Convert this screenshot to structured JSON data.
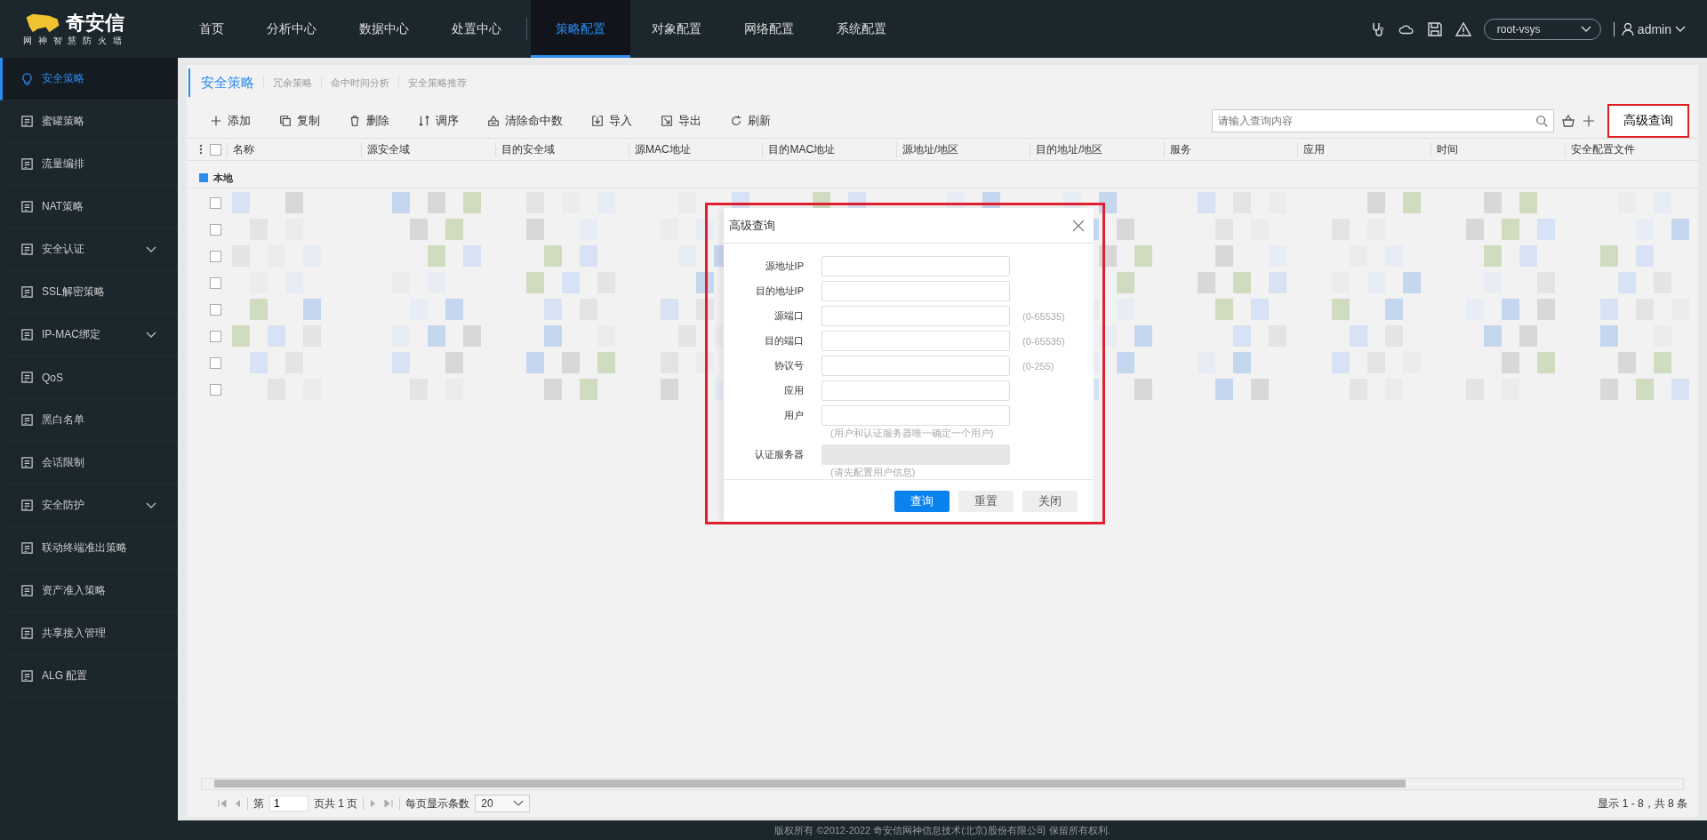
{
  "brand": {
    "name": "奇安信",
    "tagline": "网 神 智 慧 防 火 墙"
  },
  "top_nav": [
    {
      "label": "首页",
      "selected": false,
      "divider_before": false
    },
    {
      "label": "分析中心",
      "selected": false,
      "divider_before": false
    },
    {
      "label": "数据中心",
      "selected": false,
      "divider_before": false
    },
    {
      "label": "处置中心",
      "selected": false,
      "divider_before": false
    },
    {
      "label": "策略配置",
      "selected": true,
      "divider_before": true
    },
    {
      "label": "对象配置",
      "selected": false,
      "divider_before": false
    },
    {
      "label": "网络配置",
      "selected": false,
      "divider_before": false
    },
    {
      "label": "系统配置",
      "selected": false,
      "divider_before": false
    }
  ],
  "vsys_select": "root-vsys",
  "user": "admin",
  "sidebar": {
    "items": [
      {
        "label": "安全策略",
        "selected": true,
        "has_submenu": false
      },
      {
        "label": "蜜罐策略",
        "selected": false,
        "has_submenu": false
      },
      {
        "label": "流量编排",
        "selected": false,
        "has_submenu": false
      },
      {
        "label": "NAT策略",
        "selected": false,
        "has_submenu": false
      },
      {
        "label": "安全认证",
        "selected": false,
        "has_submenu": true
      },
      {
        "label": "SSL解密策略",
        "selected": false,
        "has_submenu": false
      },
      {
        "label": "IP-MAC绑定",
        "selected": false,
        "has_submenu": true
      },
      {
        "label": "QoS",
        "selected": false,
        "has_submenu": false
      },
      {
        "label": "黑白名单",
        "selected": false,
        "has_submenu": false
      },
      {
        "label": "会话限制",
        "selected": false,
        "has_submenu": false
      },
      {
        "label": "安全防护",
        "selected": false,
        "has_submenu": true
      },
      {
        "label": "联动终端准出策略",
        "selected": false,
        "has_submenu": false
      },
      {
        "label": "资产准入策略",
        "selected": false,
        "has_submenu": false
      },
      {
        "label": "共享接入管理",
        "selected": false,
        "has_submenu": false
      },
      {
        "label": "ALG 配置",
        "selected": false,
        "has_submenu": false
      }
    ]
  },
  "tabs": [
    {
      "label": "安全策略",
      "selected": true
    },
    {
      "label": "冗余策略",
      "selected": false
    },
    {
      "label": "命中时间分析",
      "selected": false
    },
    {
      "label": "安全策略推荐",
      "selected": false
    }
  ],
  "toolbar": [
    "添加",
    "复制",
    "删除",
    "调序",
    "清除命中数",
    "导入",
    "导出",
    "刷新"
  ],
  "search": {
    "placeholder": "请输入查询内容"
  },
  "advanced_button": "高级查询",
  "table": {
    "columns": [
      "名称",
      "源安全域",
      "目的安全域",
      "源MAC地址",
      "目的MAC地址",
      "源地址/地区",
      "目的地址/地区",
      "服务",
      "应用",
      "时间",
      "安全配置文件"
    ],
    "select_all": {
      "checked": false
    },
    "group": {
      "label": "本地",
      "expanded": true
    },
    "rows": [
      {
        "checked": false
      },
      {
        "checked": false
      },
      {
        "checked": false
      },
      {
        "checked": false
      },
      {
        "checked": false
      },
      {
        "checked": false
      },
      {
        "checked": false
      },
      {
        "checked": false
      }
    ]
  },
  "dialog": {
    "title": "高级查询",
    "fields": [
      {
        "label": "源地址IP",
        "disabled": false
      },
      {
        "label": "目的地址IP",
        "disabled": false
      },
      {
        "label": "源端口",
        "hint_right": "(0-65535)",
        "disabled": false
      },
      {
        "label": "目的端口",
        "hint_right": "(0-65535)",
        "disabled": false
      },
      {
        "label": "协议号",
        "hint_right": "(0-255)",
        "disabled": false
      },
      {
        "label": "应用",
        "disabled": false
      },
      {
        "label": "用户",
        "hint_below": "(用户和认证服务器唯一确定一个用户)",
        "disabled": false
      },
      {
        "label": "认证服务器",
        "hint_below": "(请先配置用户信息)",
        "disabled": true
      }
    ],
    "buttons": [
      {
        "label": "查询",
        "kind": "primary"
      },
      {
        "label": "重置",
        "kind": "secondary"
      },
      {
        "label": "关闭",
        "kind": "secondary"
      }
    ]
  },
  "pager": {
    "prefix": "第",
    "page": "1",
    "total": "页共 1 页",
    "size_label": "每页显示条数",
    "size": "20",
    "summary": "显示 1 - 8，共 8 条"
  },
  "footer": "版权所有 ©2012-2022 奇安信网神信息技术(北京)股份有限公司 保留所有权利."
}
